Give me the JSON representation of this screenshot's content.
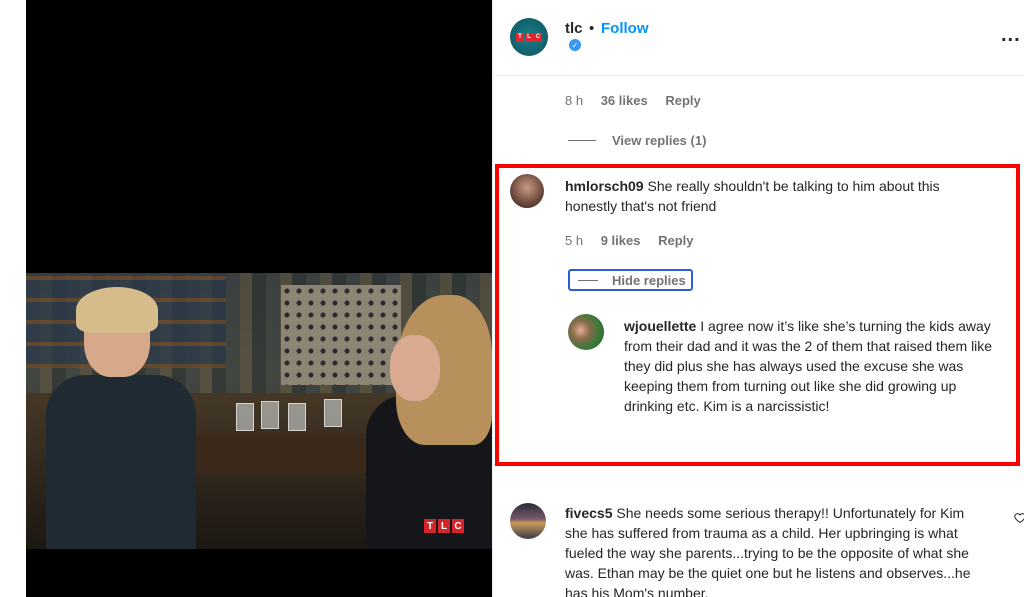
{
  "media": {
    "watermark": "TLC"
  },
  "post_header": {
    "username": "tlc",
    "separator": "•",
    "follow_label": "Follow",
    "verified_icon": "verified-badge-icon",
    "more_icon": "more-options-icon",
    "more_label": "..."
  },
  "top_comment_meta": {
    "time": "8 h",
    "likes": "36 likes",
    "reply": "Reply"
  },
  "top_view_replies": {
    "label": "View replies (1)"
  },
  "highlighted_comment": {
    "username": "hmlorsch09",
    "text": "She really shouldn't be talking to him about this honestly that's not friend",
    "meta": {
      "time": "5 h",
      "likes": "9 likes",
      "reply": "Reply"
    },
    "hide_replies_label": "Hide replies",
    "reply": {
      "username": "wjouellette",
      "text": "I agree now it’s like she’s turning the kids away from their dad and it was the 2 of them that raised them like they did plus she has always used the excuse she was keeping them from turning out like she did growing up drinking etc. Kim is a narcissistic!"
    },
    "annotation_color": "#ff0000"
  },
  "next_comment": {
    "username": "fivecs5",
    "text": "She needs some serious therapy!! Unfortunately for Kim she has suffered from trauma as a child. Her upbringing is what fueled the way she parents...trying to be the opposite of what she was. Ethan may be the quiet one but he listens and observes...he has his Mom's number."
  },
  "colors": {
    "link_blue": "#0095f6",
    "muted": "#737373",
    "text": "#262626"
  }
}
